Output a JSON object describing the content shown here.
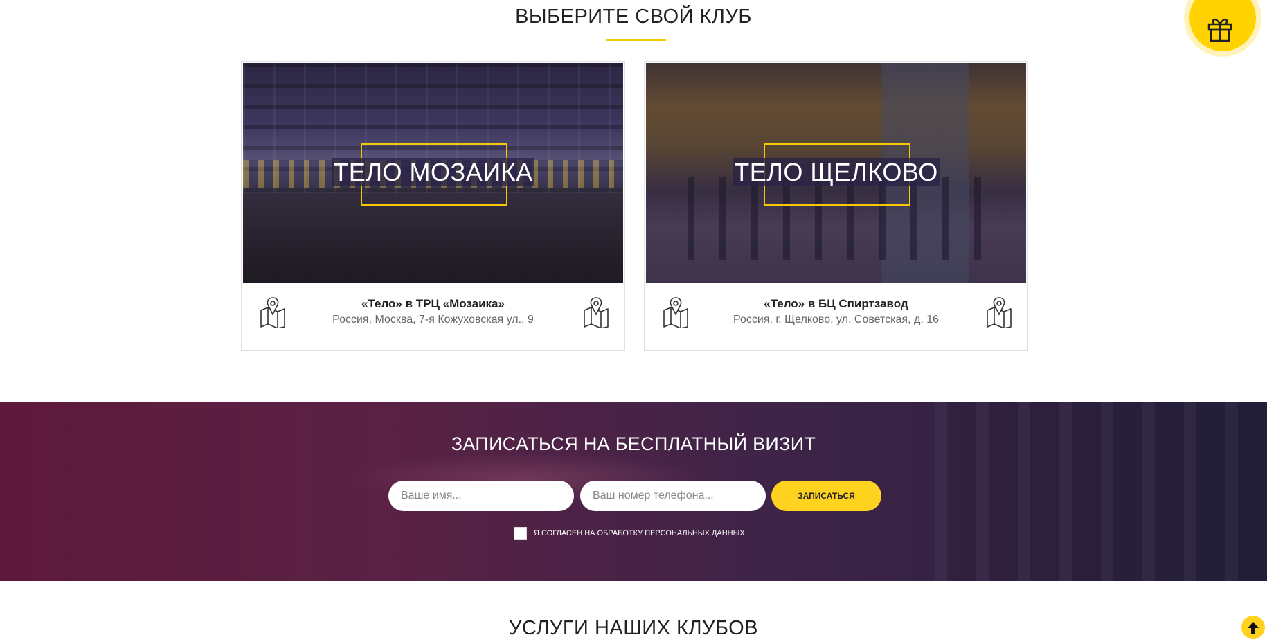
{
  "clubs_section": {
    "title": "ВЫБЕРИТЕ СВОЙ КЛУБ"
  },
  "gift_button": {
    "icon": "gift-icon"
  },
  "clubs": [
    {
      "name": "ТЕЛО МОЗАИКА",
      "title": "«Тело» в ТРЦ «Мозаика»",
      "address": "Россия, Москва, 7-я Кожуховская ул., 9",
      "icon": "map-pin-icon"
    },
    {
      "name": "ТЕЛО ЩЕЛКОВО",
      "title": "«Тело» в БЦ Спиртзавод",
      "address": "Россия, г. Щелково, ул. Советская, д. 16",
      "icon": "map-pin-icon"
    }
  ],
  "signup": {
    "title": "ЗАПИСАТЬСЯ НА БЕСПЛАТНЫЙ ВИЗИТ",
    "name_placeholder": "Ваше имя...",
    "phone_placeholder": "Ваш номер телефона...",
    "name_value": "",
    "phone_value": "",
    "submit_label": "ЗАПИСАТЬСЯ",
    "consent_label": "Я СОГЛАСЕН НА ОБРАБОТКУ ПЕРСОНАЛЬНЫХ ДАННЫХ",
    "consent_checked": false
  },
  "services_section": {
    "title": "УСЛУГИ НАШИХ КЛУБОВ"
  },
  "scroll_top_button": {
    "icon": "arrow-up-icon"
  },
  "colors": {
    "accent": "#ffd21f",
    "signup_bg_left": "#5e1a3a",
    "signup_bg_right": "#23203a"
  }
}
